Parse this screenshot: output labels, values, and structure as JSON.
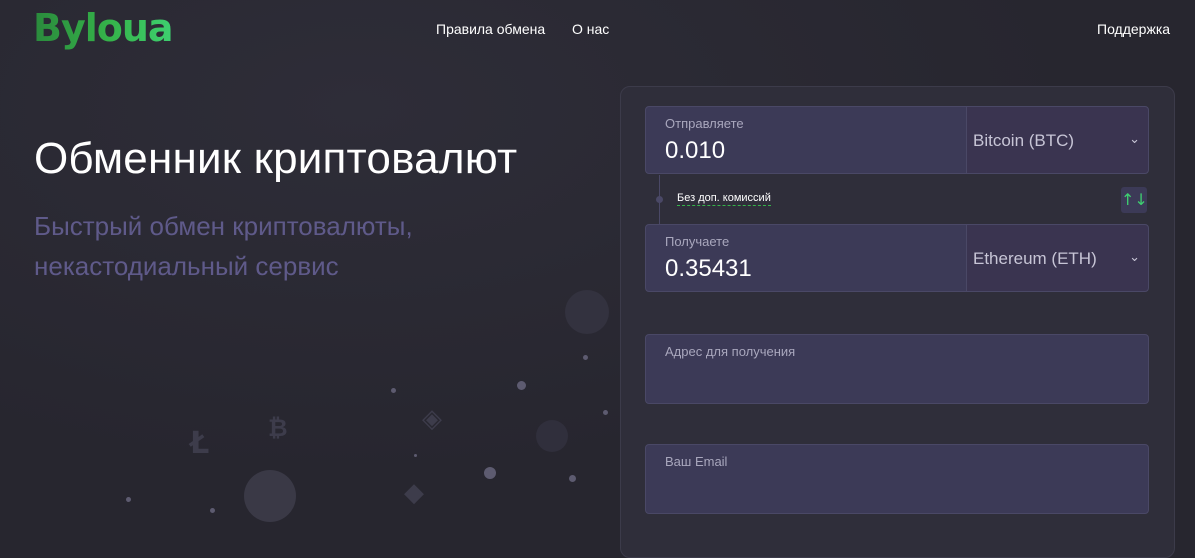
{
  "logo": "Byloua",
  "nav": {
    "rules": "Правила обмена",
    "about": "О нас",
    "support": "Поддержка"
  },
  "hero": {
    "title": "Обменник криптовалют",
    "subtitle": "Быстрый обмен криптовалюты, некастодиальный сервис"
  },
  "exchange": {
    "send": {
      "label": "Отправляете",
      "value": "0.010",
      "currency": "Bitcoin (BTC)"
    },
    "no_fee": "Без доп. комиссий",
    "swap_icon": "swap-arrows-icon",
    "receive": {
      "label": "Получаете",
      "value": "0.35431",
      "currency": "Ethereum (ETH)"
    },
    "address_label": "Адрес для получения",
    "email_label": "Ваш Email"
  },
  "colors": {
    "brand": "#35b34a",
    "background": "#27262f",
    "subtitle": "#5f5a8a",
    "field": "#3c3a57"
  }
}
